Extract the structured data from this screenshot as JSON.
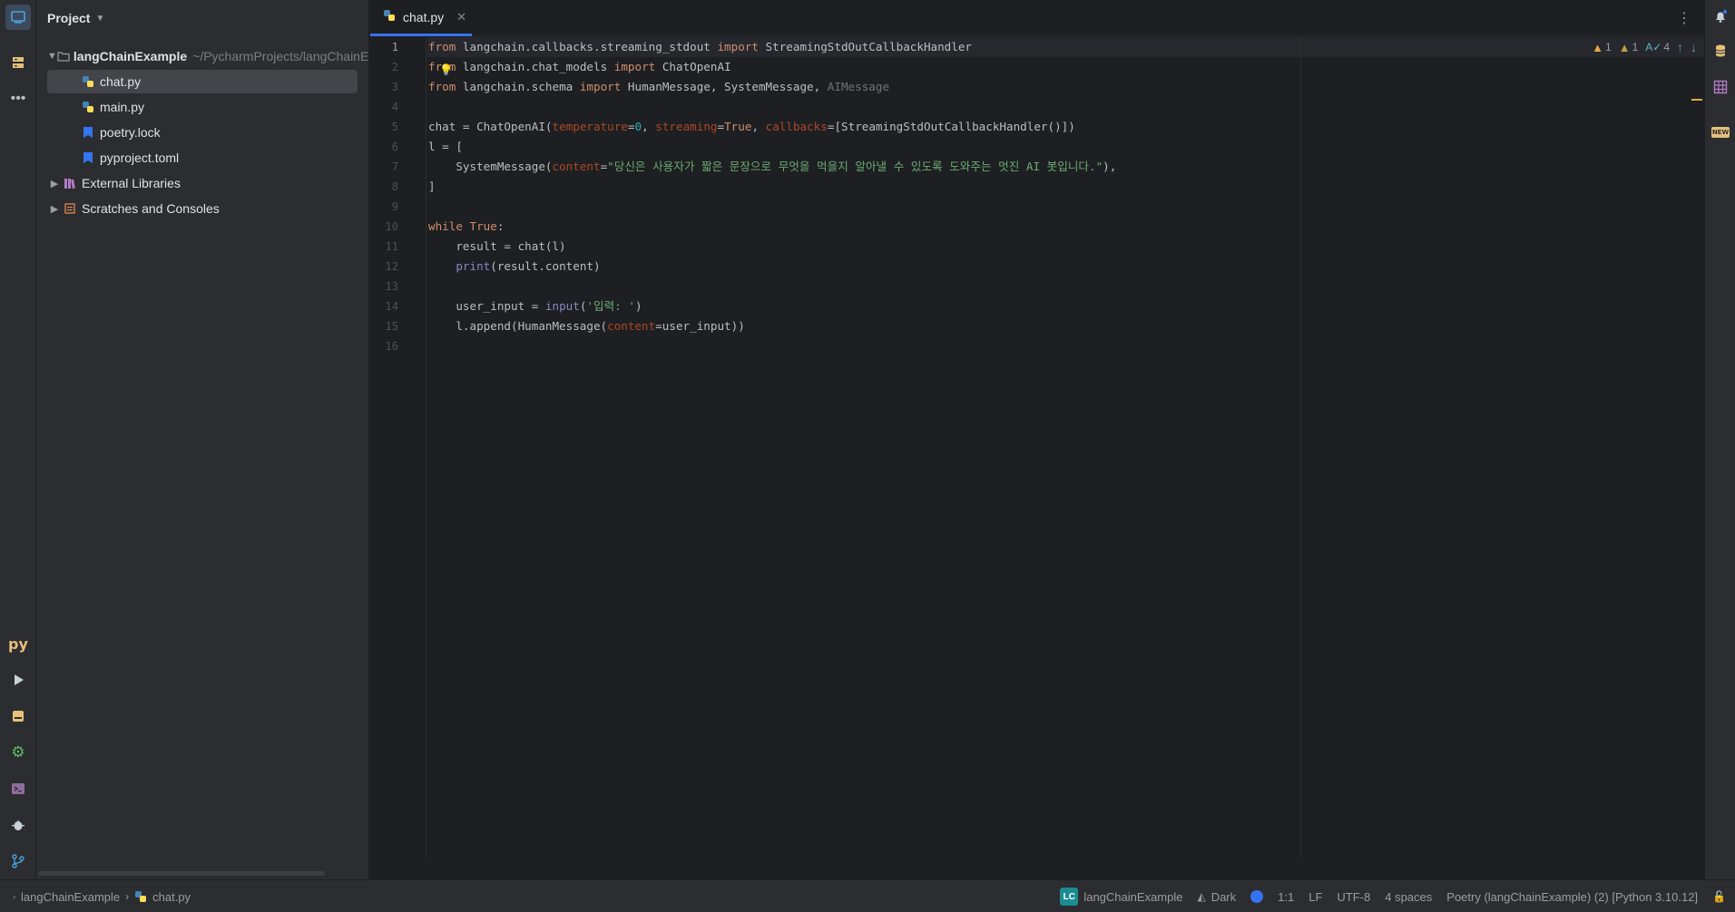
{
  "colors": {
    "accent": "#3574f0",
    "warning": "#e5a84a",
    "keyword": "#cf8e6d",
    "string": "#6aab73",
    "number": "#2aacb8",
    "param": "#aa4926"
  },
  "project_panel": {
    "title": "Project",
    "tree": [
      {
        "label": "langChainExample",
        "path": "~/PycharmProjects/langChainEx",
        "icon": "folder-icon",
        "expanded": true
      },
      {
        "label": "chat.py",
        "icon": "python-file-icon",
        "selected": true
      },
      {
        "label": "main.py",
        "icon": "python-file-icon"
      },
      {
        "label": "poetry.lock",
        "icon": "lock-file-icon"
      },
      {
        "label": "pyproject.toml",
        "icon": "toml-file-icon"
      },
      {
        "label": "External Libraries",
        "icon": "library-icon"
      },
      {
        "label": "Scratches and Consoles",
        "icon": "scratches-icon"
      }
    ]
  },
  "editor": {
    "tab_label": "chat.py",
    "inspections": {
      "warnings": "1",
      "weak_warnings": "1",
      "typos": "4"
    },
    "line_numbers": [
      "1",
      "2",
      "3",
      "4",
      "5",
      "6",
      "7",
      "8",
      "9",
      "10",
      "11",
      "12",
      "13",
      "14",
      "15",
      "16"
    ]
  },
  "code": {
    "l1": {
      "kw1": "from",
      "mod": " langchain.callbacks.streaming_stdout ",
      "kw2": "import",
      "name": " StreamingStdOutCallbackHandler"
    },
    "l2": {
      "kw1": "from",
      "mod": " langchain.chat_models ",
      "kw2": "import",
      "name": " ChatOpenAI"
    },
    "l3": {
      "kw1": "from",
      "mod": " langchain.schema ",
      "kw2": "import",
      "name": " HumanMessage, SystemMessage, ",
      "unused": "AIMessage"
    },
    "l5": {
      "a": "chat = ChatOpenAI(",
      "p1": "temperature",
      "b": "=",
      "n1": "0",
      "c": ", ",
      "p2": "streaming",
      "d": "=",
      "t": "True",
      "e": ", ",
      "p3": "callbacks",
      "f": "=[StreamingStdOutCallbackHandler()])"
    },
    "l6": {
      "a": "l = ["
    },
    "l7": {
      "a": "    SystemMessage(",
      "p": "content",
      "b": "=",
      "s": "\"당신은 사용자가 짧은 문장으로 무엇을 먹을지 알아낼 수 있도록 도와주는 멋진 AI 봇입니다.\"",
      "c": "),"
    },
    "l8": {
      "a": "]"
    },
    "l10": {
      "kw": "while",
      "a": " ",
      "t": "True",
      "b": ":"
    },
    "l11": {
      "a": "    result = chat(l)"
    },
    "l12": {
      "a": "    ",
      "fn": "print",
      "b": "(result.content)"
    },
    "l14": {
      "a": "    user_input = ",
      "fn": "input",
      "b": "(",
      "s": "'입력: '",
      "c": ")"
    },
    "l15": {
      "a": "    l.append(HumanMessage(",
      "p": "content",
      "b": "=user_input))"
    }
  },
  "status_bar": {
    "breadcrumb_project": "langChainExample",
    "breadcrumb_file": "chat.py",
    "project_badge": "LC",
    "project_name": "langChainExample",
    "theme": "Dark",
    "position": "1:1",
    "line_ending": "LF",
    "encoding": "UTF-8",
    "indent": "4 spaces",
    "interpreter": "Poetry (langChainExample) (2) [Python 3.10.12]"
  }
}
